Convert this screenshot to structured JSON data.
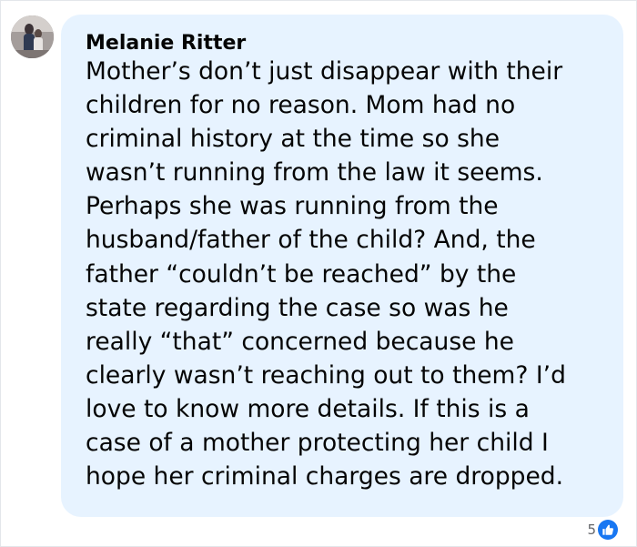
{
  "comment": {
    "author": "Melanie Ritter",
    "lines": [
      "Mother’s don’t just disappear with their",
      "children for no reason. Mom had no",
      "criminal history at the time so she",
      "wasn’t running from the law it seems.",
      "Perhaps she was running from the",
      "husband/father of the child? And, the",
      "father “couldn’t be reached” by the",
      "state regarding the case so was he",
      "really “that” concerned because he",
      "clearly wasn’t reaching out to them? I’d",
      "love to know more details. If this is a",
      "case of a mother protecting her child I",
      "hope her criminal charges are dropped."
    ],
    "reaction_count": "5",
    "reaction_icon": "like-icon"
  },
  "colors": {
    "bubble_background": "#e7f3ff",
    "text": "#050505",
    "meta_text": "#65676b",
    "like_blue": "#1877f2"
  }
}
